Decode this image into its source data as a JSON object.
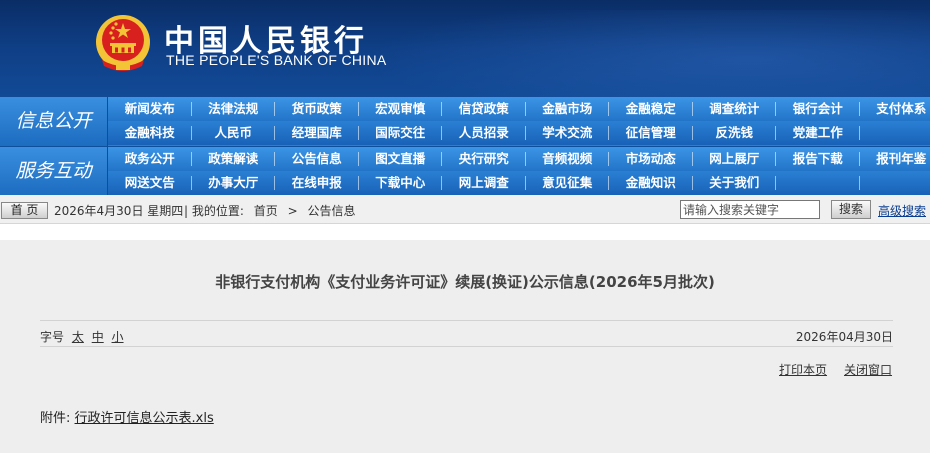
{
  "header": {
    "name_cn": "中国人民银行",
    "name_en": "THE PEOPLE'S BANK OF CHINA",
    "colors": {
      "header_bg": "#0f3f86",
      "nav_bg": "#2a7fd0",
      "emblem_red": "#d8201f",
      "emblem_gold": "#f4c437"
    }
  },
  "nav": {
    "groups": [
      {
        "label": "信息公开",
        "rows": [
          [
            "新闻发布",
            "法律法规",
            "货币政策",
            "宏观审慎",
            "信贷政策",
            "金融市场",
            "金融稳定",
            "调查统计",
            "银行会计",
            "支付体系"
          ],
          [
            "金融科技",
            "人民币",
            "经理国库",
            "国际交往",
            "人员招录",
            "学术交流",
            "征信管理",
            "反洗钱",
            "党建工作",
            ""
          ]
        ]
      },
      {
        "label": "服务互动",
        "rows": [
          [
            "政务公开",
            "政策解读",
            "公告信息",
            "图文直播",
            "央行研究",
            "音频视频",
            "市场动态",
            "网上展厅",
            "报告下载",
            "报刊年鉴"
          ],
          [
            "网送文告",
            "办事大厅",
            "在线申报",
            "下载中心",
            "网上调查",
            "意见征集",
            "金融知识",
            "关于我们",
            "",
            ""
          ]
        ]
      }
    ]
  },
  "toolbar": {
    "home_label": "首 页",
    "date_text": "2026年4月30日 星期四",
    "location_label": "| 我的位置:",
    "breadcrumb": [
      "首页",
      ">",
      "公告信息"
    ],
    "search_placeholder": "请输入搜索关键字",
    "search_button": "搜索",
    "advanced_search": "高级搜索"
  },
  "article": {
    "title": "非银行支付机构《支付业务许可证》续展(换证)公示信息(2026年5月批次)",
    "font_size_label": "字号",
    "font_sizes": [
      "太",
      "中",
      "小"
    ],
    "publish_date": "2026年04月30日",
    "print_label": "打印本页",
    "close_label": "关闭窗口",
    "attachment_label": "附件:",
    "attachment_file": "行政许可信息公示表.xls"
  }
}
